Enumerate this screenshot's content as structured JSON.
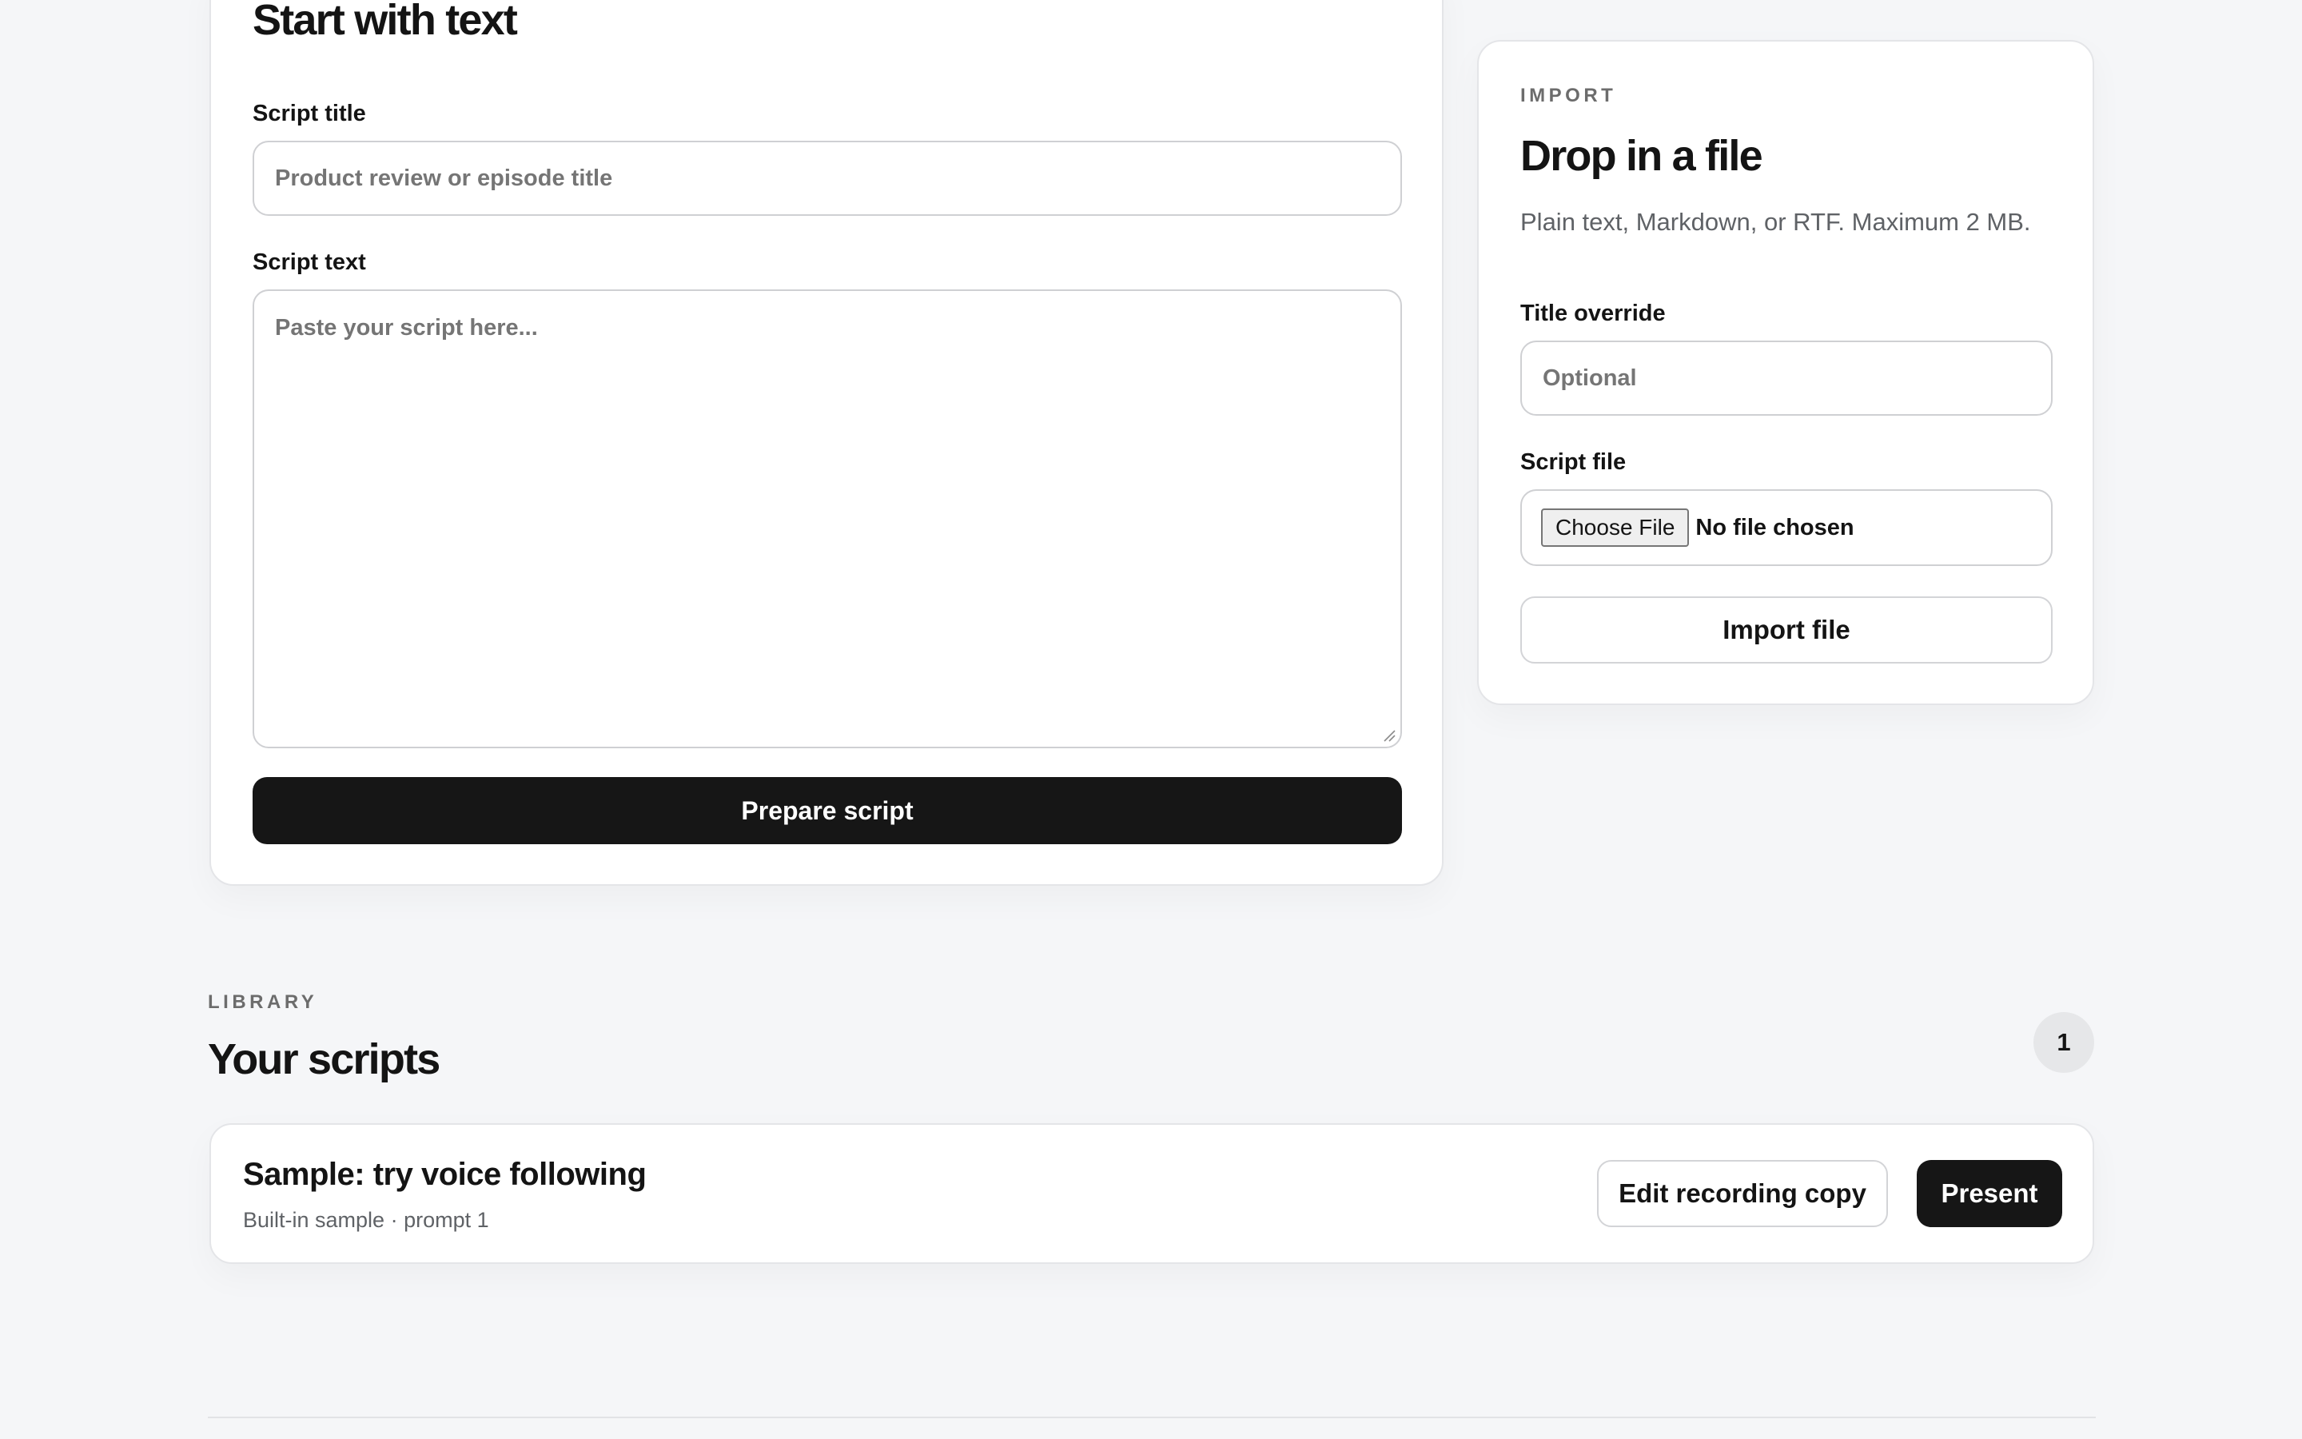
{
  "compose": {
    "heading": "Start with text",
    "title_label": "Script title",
    "title_placeholder": "Product review or episode title",
    "text_label": "Script text",
    "text_placeholder": "Paste your script here...",
    "submit_label": "Prepare script"
  },
  "import": {
    "eyebrow": "IMPORT",
    "heading": "Drop in a file",
    "description": "Plain text, Markdown, or RTF. Maximum 2 MB.",
    "title_override_label": "Title override",
    "title_override_placeholder": "Optional",
    "file_label": "Script file",
    "choose_file_label": "Choose File",
    "file_status": "No file chosen",
    "submit_label": "Import file"
  },
  "library": {
    "eyebrow": "LIBRARY",
    "heading": "Your scripts",
    "count": "1",
    "items": [
      {
        "title": "Sample: try voice following",
        "meta": "Built-in sample · prompt 1",
        "edit_label": "Edit recording copy",
        "present_label": "Present"
      }
    ]
  }
}
